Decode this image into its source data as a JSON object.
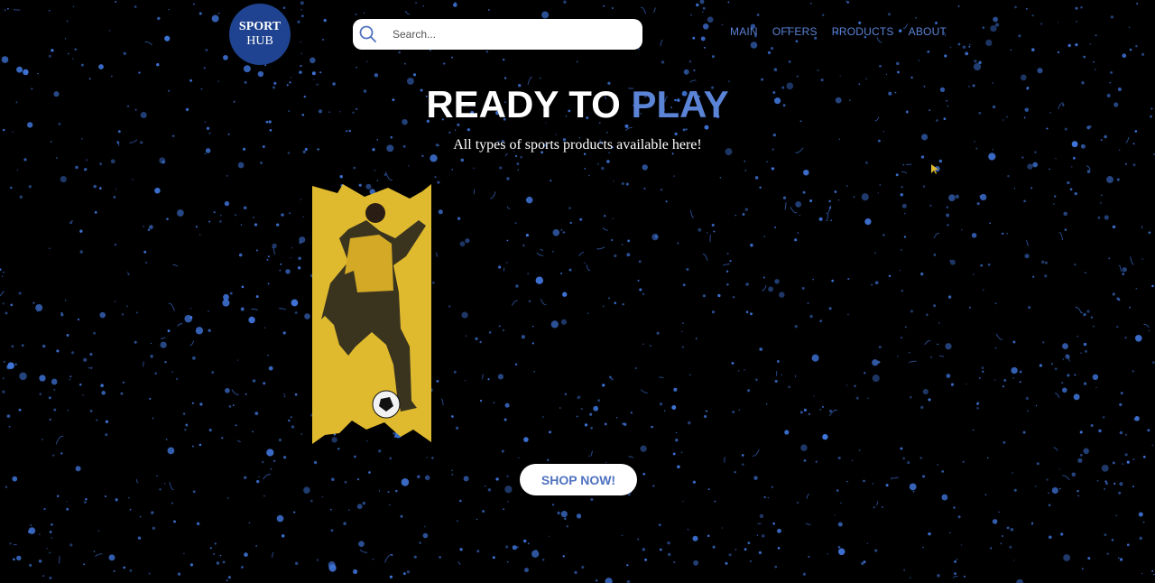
{
  "logo": {
    "line1": "SPORT",
    "line2": "HUB",
    "color": "#1f4390"
  },
  "search": {
    "placeholder": "Search...",
    "icon": "search-icon"
  },
  "nav": {
    "items": [
      "MAIN",
      "OFFERS",
      "PRODUCTS",
      "ABOUT"
    ]
  },
  "hero": {
    "title_main": "READY TO",
    "title_accent": "PLAY",
    "subtitle": "All types of sports products available here!"
  },
  "cta": {
    "label": "SHOP NOW!"
  },
  "colors": {
    "background": "#000000",
    "accent": "#5b83d6",
    "speckle": "#3f74d8",
    "card_yellow": "#e0ba2e"
  }
}
